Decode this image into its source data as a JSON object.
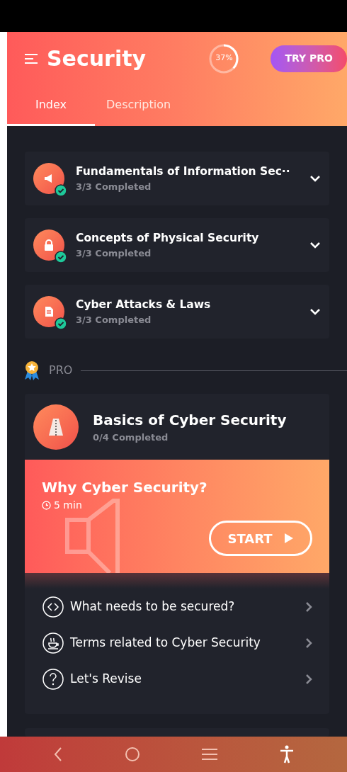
{
  "header": {
    "title": "Security",
    "progress": {
      "label": "37%",
      "level": 0.37
    },
    "pro_button": "TRY PRO"
  },
  "tabs": [
    {
      "label": "Index",
      "selected": true
    },
    {
      "label": "Description",
      "selected": false
    }
  ],
  "chapters": [
    {
      "title": "Fundamentals of Information Sec··",
      "status": "3/3 Completed",
      "kind": "megaphone",
      "completed": true
    },
    {
      "title": "Concepts of Physical Security",
      "status": "3/3 Completed",
      "kind": "lock",
      "completed": true
    },
    {
      "title": "Cyber Attacks & Laws",
      "status": "3/3 Completed",
      "kind": "document",
      "completed": true
    }
  ],
  "pro_section": {
    "label": "PRO"
  },
  "pro_course": {
    "title": "Basics of Cyber Security",
    "status": "0/4 Completed",
    "featured": {
      "title": "Why Cyber Security?",
      "duration": "5 min",
      "button": "START"
    },
    "lessons": [
      {
        "title": "What needs to be secured?",
        "kind": "code"
      },
      {
        "title": "Terms related to Cyber Security",
        "kind": "cup"
      },
      {
        "title": "Let's Revise",
        "kind": "question"
      }
    ]
  }
}
